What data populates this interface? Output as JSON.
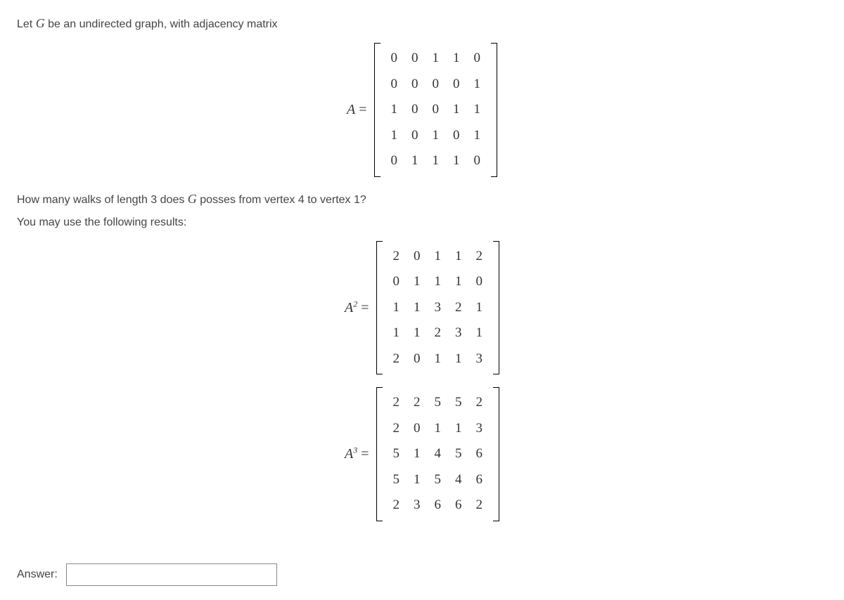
{
  "intro": {
    "prefix": "Let ",
    "graph_var": "G",
    "suffix": " be an undirected graph, with adjacency matrix"
  },
  "matrix_A": {
    "label_var": "A",
    "label_after": " = ",
    "rows": [
      [
        "0",
        "0",
        "1",
        "1",
        "0"
      ],
      [
        "0",
        "0",
        "0",
        "0",
        "1"
      ],
      [
        "1",
        "0",
        "0",
        "1",
        "1"
      ],
      [
        "1",
        "0",
        "1",
        "0",
        "1"
      ],
      [
        "0",
        "1",
        "1",
        "1",
        "0"
      ]
    ]
  },
  "question": {
    "prefix": "How many walks of length 3 does ",
    "graph_var": "G",
    "suffix": " posses from vertex 4 to vertex 1?"
  },
  "hint": "You may use the following results:",
  "matrix_A2": {
    "label_var": "A",
    "label_sup": "2",
    "label_after": " = ",
    "rows": [
      [
        "2",
        "0",
        "1",
        "1",
        "2"
      ],
      [
        "0",
        "1",
        "1",
        "1",
        "0"
      ],
      [
        "1",
        "1",
        "3",
        "2",
        "1"
      ],
      [
        "1",
        "1",
        "2",
        "3",
        "1"
      ],
      [
        "2",
        "0",
        "1",
        "1",
        "3"
      ]
    ]
  },
  "matrix_A3": {
    "label_var": "A",
    "label_sup": "3",
    "label_after": " = ",
    "rows": [
      [
        "2",
        "2",
        "5",
        "5",
        "2"
      ],
      [
        "2",
        "0",
        "1",
        "1",
        "3"
      ],
      [
        "5",
        "1",
        "4",
        "5",
        "6"
      ],
      [
        "5",
        "1",
        "5",
        "4",
        "6"
      ],
      [
        "2",
        "3",
        "6",
        "6",
        "2"
      ]
    ]
  },
  "answer": {
    "label": "Answer:",
    "value": ""
  }
}
